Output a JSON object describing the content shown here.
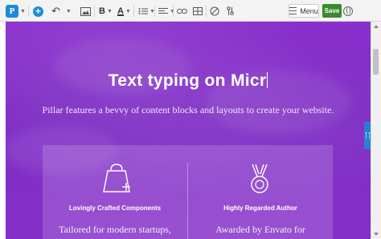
{
  "toolbar": {
    "logo_letter": "P",
    "bold_label": "B",
    "text_color_label": "A",
    "menu_label": "Menu",
    "save_label": "Save"
  },
  "hero": {
    "title": "Text typing on Micr",
    "subtitle": "Pillar features a bevvy of content blocks and layouts to create your website."
  },
  "features": [
    {
      "title": "Lovingly Crafted Components",
      "text": "Tailored for modern startups,",
      "icon": "shopping-bag-plus-icon"
    },
    {
      "title": "Highly Regarded Author",
      "text": "Awarded by Envato for",
      "icon": "medal-icon"
    }
  ],
  "colors": {
    "hero_purple": "#8a30cc",
    "save_green": "#3a8a2e",
    "accent_blue": "#1a8cd8"
  }
}
